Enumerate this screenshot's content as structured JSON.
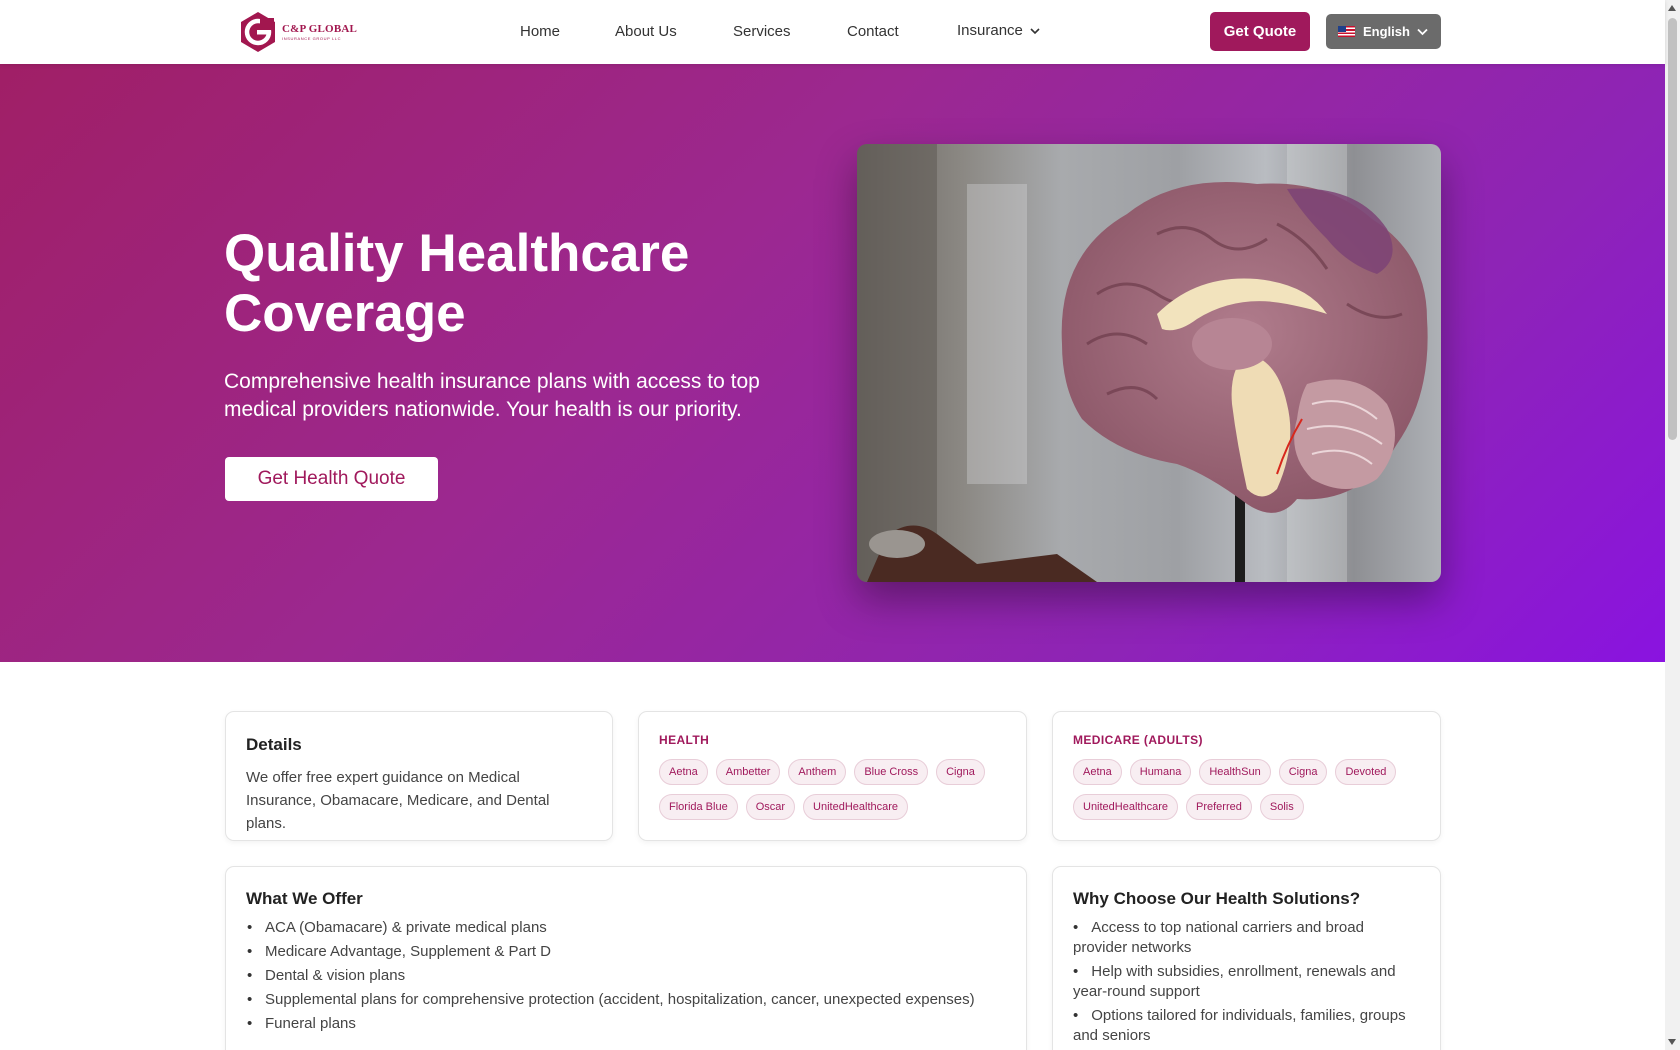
{
  "header": {
    "logo_name": "C&P GLOBAL",
    "logo_sub": "INSURANCE GROUP LLC",
    "nav": [
      {
        "label": "Home"
      },
      {
        "label": "About Us"
      },
      {
        "label": "Services"
      },
      {
        "label": "Contact"
      },
      {
        "label": "Insurance",
        "has_dropdown": true
      }
    ],
    "quote_button": "Get Quote",
    "language": {
      "label": "English",
      "flag": "us-flag-icon"
    }
  },
  "hero": {
    "title": "Quality Healthcare Coverage",
    "subtitle": "Comprehensive health insurance plans with access to top medical providers nationwide. Your health is our priority.",
    "cta": "Get Health Quote",
    "image": "anatomical brain model photo"
  },
  "details_card": {
    "title": "Details",
    "text": "We offer free expert guidance on Medical Insurance, Obamacare, Medicare, and Dental plans."
  },
  "health_card": {
    "label": "HEALTH",
    "carriers": [
      "Aetna",
      "Ambetter",
      "Anthem",
      "Blue Cross",
      "Cigna",
      "Florida Blue",
      "Oscar",
      "UnitedHealthcare"
    ]
  },
  "medicare_card": {
    "label": "MEDICARE (ADULTS)",
    "carriers": [
      "Aetna",
      "Humana",
      "HealthSun",
      "Cigna",
      "Devoted",
      "UnitedHealthcare",
      "Preferred",
      "Solis"
    ]
  },
  "offer_card": {
    "title": "What We Offer",
    "items": [
      "ACA (Obamacare) & private medical plans",
      "Medicare Advantage, Supplement & Part D",
      "Dental & vision plans",
      "Supplemental plans for comprehensive protection (accident, hospitalization, cancer, unexpected expenses)",
      "Funeral plans"
    ]
  },
  "why_card": {
    "title": "Why Choose Our Health Solutions?",
    "items": [
      "Access to top national carriers and broad provider networks",
      "Help with subsidies, enrollment, renewals and year-round support",
      "Options tailored for individuals, families, groups and seniors"
    ]
  },
  "colors": {
    "brand": "#a0195c",
    "hero_gradient_start": "#a01f66",
    "hero_gradient_end": "#8a13e0",
    "language_button": "#6b6b6b"
  }
}
